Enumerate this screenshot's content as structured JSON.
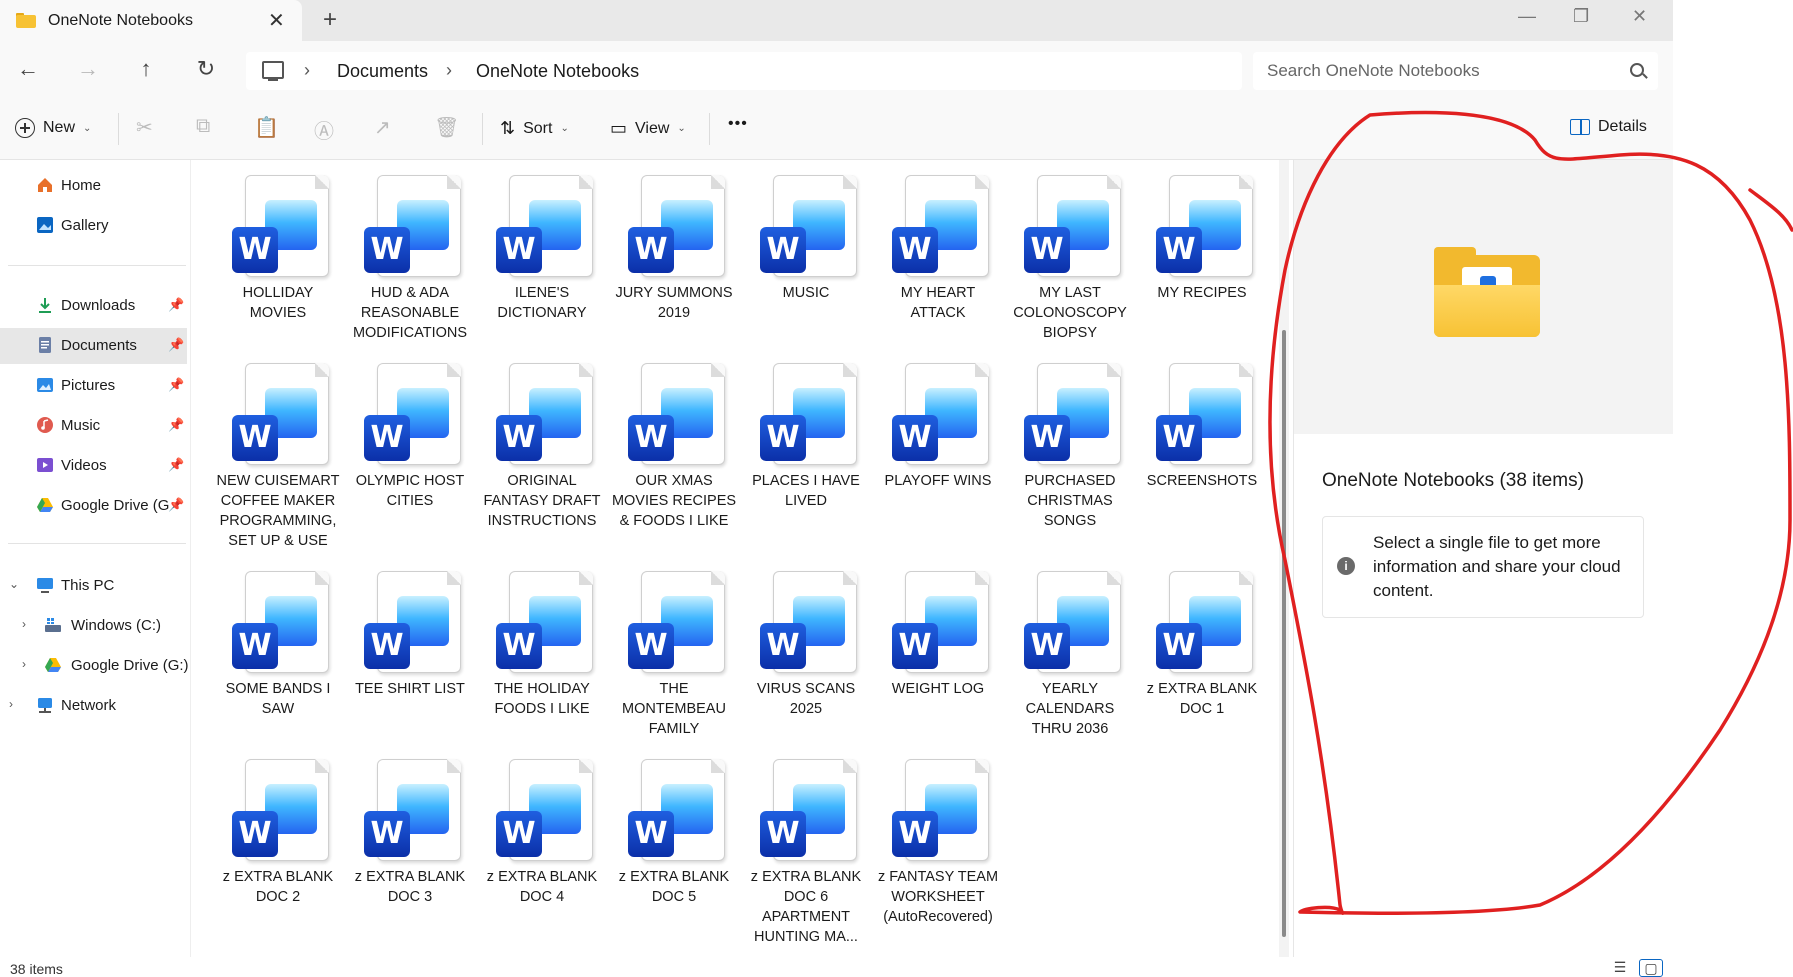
{
  "window": {
    "tab_title": "OneNote Notebooks",
    "close_glyph": "✕",
    "newtab_glyph": "+",
    "minimize_glyph": "—",
    "restore_glyph": "❐",
    "close_window_glyph": "✕"
  },
  "nav": {
    "back": "←",
    "forward": "→",
    "up": "↑",
    "refresh": "↻"
  },
  "address": {
    "sep": "›",
    "crumbs": [
      "Documents",
      "OneNote Notebooks"
    ]
  },
  "search": {
    "placeholder": "Search OneNote Notebooks"
  },
  "toolbar": {
    "new_label": "New",
    "sort_label": "Sort",
    "view_label": "View",
    "more_label": "•••",
    "details_label": "Details",
    "chevron": "⌄",
    "cut_glyph": "✂",
    "copy_glyph": "⧉",
    "paste_glyph": "📋",
    "rename_glyph": "Ⓐ",
    "share_glyph": "↗",
    "delete_glyph": "🗑",
    "sort_glyph": "⇅",
    "view_glyph": "▭"
  },
  "sidebar": {
    "pin_glyph": "📌",
    "expand_glyph": "›",
    "collapse_glyph": "⌄",
    "items": [
      {
        "label": "Home",
        "icon": "home-icon",
        "color": "#e8702a"
      },
      {
        "label": "Gallery",
        "icon": "gallery-icon",
        "color": "#0a66c2"
      },
      {
        "label": "Downloads",
        "icon": "downloads-icon",
        "color": "#1f9d55"
      },
      {
        "label": "Documents",
        "icon": "documents-icon",
        "color": "#6b7fa6"
      },
      {
        "label": "Pictures",
        "icon": "pictures-icon",
        "color": "#2b8ae6"
      },
      {
        "label": "Music",
        "icon": "music-icon",
        "color": "#e05a4f"
      },
      {
        "label": "Videos",
        "icon": "videos-icon",
        "color": "#7b4fd1"
      },
      {
        "label": "Google Drive (G",
        "icon": "google-drive-icon",
        "color": "#34a853"
      },
      {
        "label": "This PC",
        "icon": "this-pc-icon",
        "color": "#2b8ae6"
      },
      {
        "label": "Windows (C:)",
        "icon": "drive-c-icon",
        "color": "#5a6f8f"
      },
      {
        "label": "Google Drive (G:)",
        "icon": "google-drive-icon",
        "color": "#34a853"
      },
      {
        "label": "Network",
        "icon": "network-icon",
        "color": "#2b8ae6"
      }
    ]
  },
  "files": [
    "HOLLIDAY MOVIES",
    "HUD & ADA REASONABLE MODIFICATIONS",
    "ILENE'S DICTIONARY",
    "JURY SUMMONS 2019",
    "MUSIC",
    "MY HEART ATTACK",
    "MY LAST COLONOSCOPY BIOPSY",
    "MY RECIPES",
    "NEW CUISEMART COFFEE MAKER PROGRAMMING, SET UP & USE",
    "OLYMPIC HOST CITIES",
    "ORIGINAL FANTASY DRAFT INSTRUCTIONS",
    "OUR XMAS MOVIES RECIPES & FOODS I LIKE",
    "PLACES I HAVE LIVED",
    "PLAYOFF WINS",
    "PURCHASED CHRISTMAS SONGS",
    "SCREENSHOTS",
    "SOME BANDS I SAW",
    "TEE SHIRT LIST",
    "THE HOLIDAY FOODS I LIKE",
    "THE MONTEMBEAU FAMILY",
    "VIRUS SCANS 2025",
    "WEIGHT LOG",
    "YEARLY CALENDARS THRU 2036",
    "z EXTRA BLANK DOC 1",
    "z EXTRA BLANK DOC 2",
    "z EXTRA BLANK DOC 3",
    "z EXTRA BLANK DOC 4",
    "z EXTRA BLANK DOC 5",
    "z EXTRA BLANK DOC 6 APARTMENT HUNTING MA...",
    "z FANTASY TEAM WORKSHEET (AutoRecovered)"
  ],
  "word_badge": "W",
  "details_pane": {
    "title": "OneNote Notebooks (38 items)",
    "info_glyph": "i",
    "info_text": "Select a single file to get more information and share your cloud content."
  },
  "status": {
    "count": "38 items",
    "list_view_glyph": "☰",
    "tile_view_glyph": "▢"
  },
  "colors": {
    "accent": "#0a66c2",
    "annotation": "#e02020",
    "word_blue": "#0b2fa8"
  }
}
